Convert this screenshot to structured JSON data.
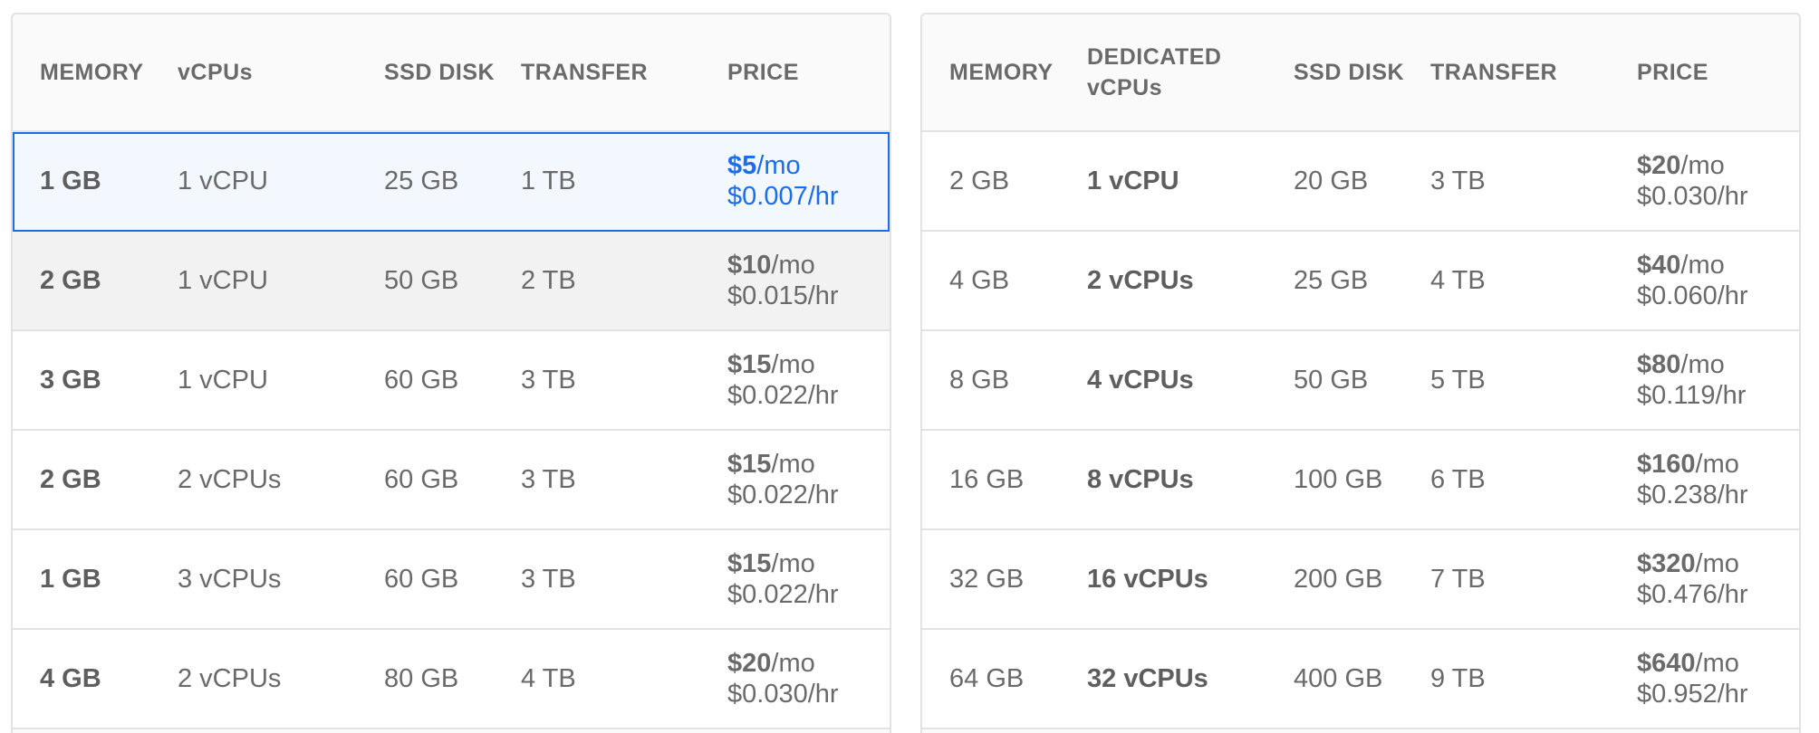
{
  "left_table": {
    "headers": [
      "MEMORY",
      "vCPUs",
      "SSD DISK",
      "TRANSFER",
      "PRICE"
    ],
    "rows": [
      {
        "memory": "1 GB",
        "vcpus": "1 vCPU",
        "disk": "25 GB",
        "transfer": "1 TB",
        "price_mo": "$5",
        "mo_unit": "/mo",
        "price_hr": "$0.007/hr",
        "state": "selected"
      },
      {
        "memory": "2 GB",
        "vcpus": "1 vCPU",
        "disk": "50 GB",
        "transfer": "2 TB",
        "price_mo": "$10",
        "mo_unit": "/mo",
        "price_hr": "$0.015/hr",
        "state": "hover"
      },
      {
        "memory": "3 GB",
        "vcpus": "1 vCPU",
        "disk": "60 GB",
        "transfer": "3 TB",
        "price_mo": "$15",
        "mo_unit": "/mo",
        "price_hr": "$0.022/hr",
        "state": ""
      },
      {
        "memory": "2 GB",
        "vcpus": "2 vCPUs",
        "disk": "60 GB",
        "transfer": "3 TB",
        "price_mo": "$15",
        "mo_unit": "/mo",
        "price_hr": "$0.022/hr",
        "state": ""
      },
      {
        "memory": "1 GB",
        "vcpus": "3 vCPUs",
        "disk": "60 GB",
        "transfer": "3 TB",
        "price_mo": "$15",
        "mo_unit": "/mo",
        "price_hr": "$0.022/hr",
        "state": ""
      },
      {
        "memory": "4 GB",
        "vcpus": "2 vCPUs",
        "disk": "80 GB",
        "transfer": "4 TB",
        "price_mo": "$20",
        "mo_unit": "/mo",
        "price_hr": "$0.030/hr",
        "state": ""
      }
    ]
  },
  "right_table": {
    "headers": [
      "MEMORY",
      "DEDICATED vCPUs",
      "SSD DISK",
      "TRANSFER",
      "PRICE"
    ],
    "rows": [
      {
        "memory": "2 GB",
        "vcpus": "1 vCPU",
        "disk": "20 GB",
        "transfer": "3 TB",
        "price_mo": "$20",
        "mo_unit": "/mo",
        "price_hr": "$0.030/hr"
      },
      {
        "memory": "4 GB",
        "vcpus": "2 vCPUs",
        "disk": "25 GB",
        "transfer": "4 TB",
        "price_mo": "$40",
        "mo_unit": "/mo",
        "price_hr": "$0.060/hr"
      },
      {
        "memory": "8 GB",
        "vcpus": "4 vCPUs",
        "disk": "50 GB",
        "transfer": "5 TB",
        "price_mo": "$80",
        "mo_unit": "/mo",
        "price_hr": "$0.119/hr"
      },
      {
        "memory": "16 GB",
        "vcpus": "8 vCPUs",
        "disk": "100 GB",
        "transfer": "6 TB",
        "price_mo": "$160",
        "mo_unit": "/mo",
        "price_hr": "$0.238/hr"
      },
      {
        "memory": "32 GB",
        "vcpus": "16 vCPUs",
        "disk": "200 GB",
        "transfer": "7 TB",
        "price_mo": "$320",
        "mo_unit": "/mo",
        "price_hr": "$0.476/hr"
      },
      {
        "memory": "64 GB",
        "vcpus": "32 vCPUs",
        "disk": "400 GB",
        "transfer": "9 TB",
        "price_mo": "$640",
        "mo_unit": "/mo",
        "price_hr": "$0.952/hr"
      }
    ]
  },
  "colors": {
    "accent": "#1a6ee8",
    "border": "#e2e2e2",
    "text": "#6a6a6a",
    "hover_bg": "#f2f2f2",
    "selected_bg": "#f3f8ff"
  }
}
